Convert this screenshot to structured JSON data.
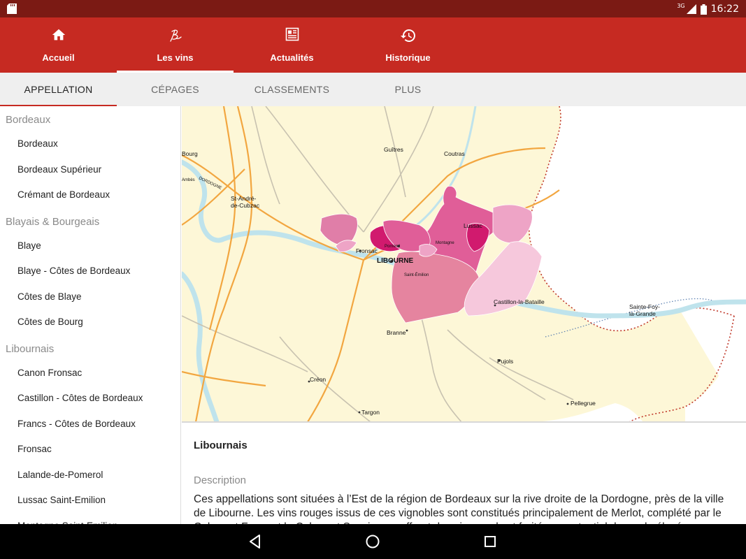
{
  "status_bar": {
    "network": "3G",
    "time": "16:22"
  },
  "app_nav": {
    "items": [
      {
        "label": "Accueil",
        "icon": "home-icon"
      },
      {
        "label": "Les vins",
        "icon": "wine-signature-icon"
      },
      {
        "label": "Actualités",
        "icon": "newspaper-icon"
      },
      {
        "label": "Historique",
        "icon": "history-icon"
      }
    ],
    "active": "Les vins"
  },
  "tabs": {
    "items": [
      "APPELLATION",
      "CÉPAGES",
      "CLASSEMENTS",
      "PLUS"
    ],
    "active": "APPELLATION"
  },
  "sidebar": {
    "groups": [
      {
        "header": "Bordeaux",
        "items": [
          "Bordeaux",
          "Bordeaux Supérieur",
          "Crémant de Bordeaux"
        ]
      },
      {
        "header": "Blayais & Bourgeais",
        "items": [
          "Blaye",
          "Blaye - Côtes de Bordeaux",
          "Côtes de Blaye",
          "Côtes de Bourg"
        ]
      },
      {
        "header": "Libournais",
        "items": [
          "Canon Fronsac",
          "Castillon - Côtes de Bordeaux",
          "Francs - Côtes de Bordeaux",
          "Fronsac",
          "Lalande-de-Pomerol",
          "Lussac Saint-Emilion",
          "Montagne Saint-Emilion"
        ]
      }
    ]
  },
  "map": {
    "labels": {
      "bourg": "Bourg",
      "guitres": "Guîtres",
      "coutras": "Coutras",
      "dordogne": "DORDOGNE",
      "ambes": "Ambès",
      "st_andre_1": "St-André-",
      "st_andre_2": "de-Cubzac",
      "fronsac": "Fronsac",
      "pomerol": "Pomerol",
      "libourne": "LIBOURNE",
      "montagne": "Montagne",
      "lussac": "Lussac",
      "saint_emilion": "Saint-Émilion",
      "castillon": "Castillon-la-Bataille",
      "sainte_foy_1": "Sainte-Foy-",
      "sainte_foy_2": "la-Grande",
      "branne": "Branne",
      "pujols": "Pujols",
      "creon": "Créon",
      "targon": "Targon",
      "pellegrue": "Pellegrue"
    },
    "colors": {
      "background": "#fdf7d7",
      "roads": "#f2a640",
      "minor_roads": "#c8c2b0",
      "water": "#bfe3ec",
      "appellation_dark": "#d11a6e",
      "appellation_mid": "#e05e98",
      "appellation_light": "#eea4c6",
      "appellation_pale": "#f6c8dc",
      "border": "#c0392b"
    }
  },
  "detail": {
    "title": "Libournais",
    "description_label": "Description",
    "description": "Ces appellations sont situées à l’Est de la région de Bordeaux sur la rive droite de la Dordogne, près de la ville de Libourne. Les vins rouges issus de ces vignobles sont constitués principalement de Merlot, complété par le Cabernet Franc et le Cabernet Sauvignon, offrant des vins ronds et fruités au potentiel de garde élevé."
  },
  "colors": {
    "status_bar": "#7b1a14",
    "app_bar": "#c62a22",
    "tab_bar": "#efefef",
    "accent": "#c62a22"
  }
}
